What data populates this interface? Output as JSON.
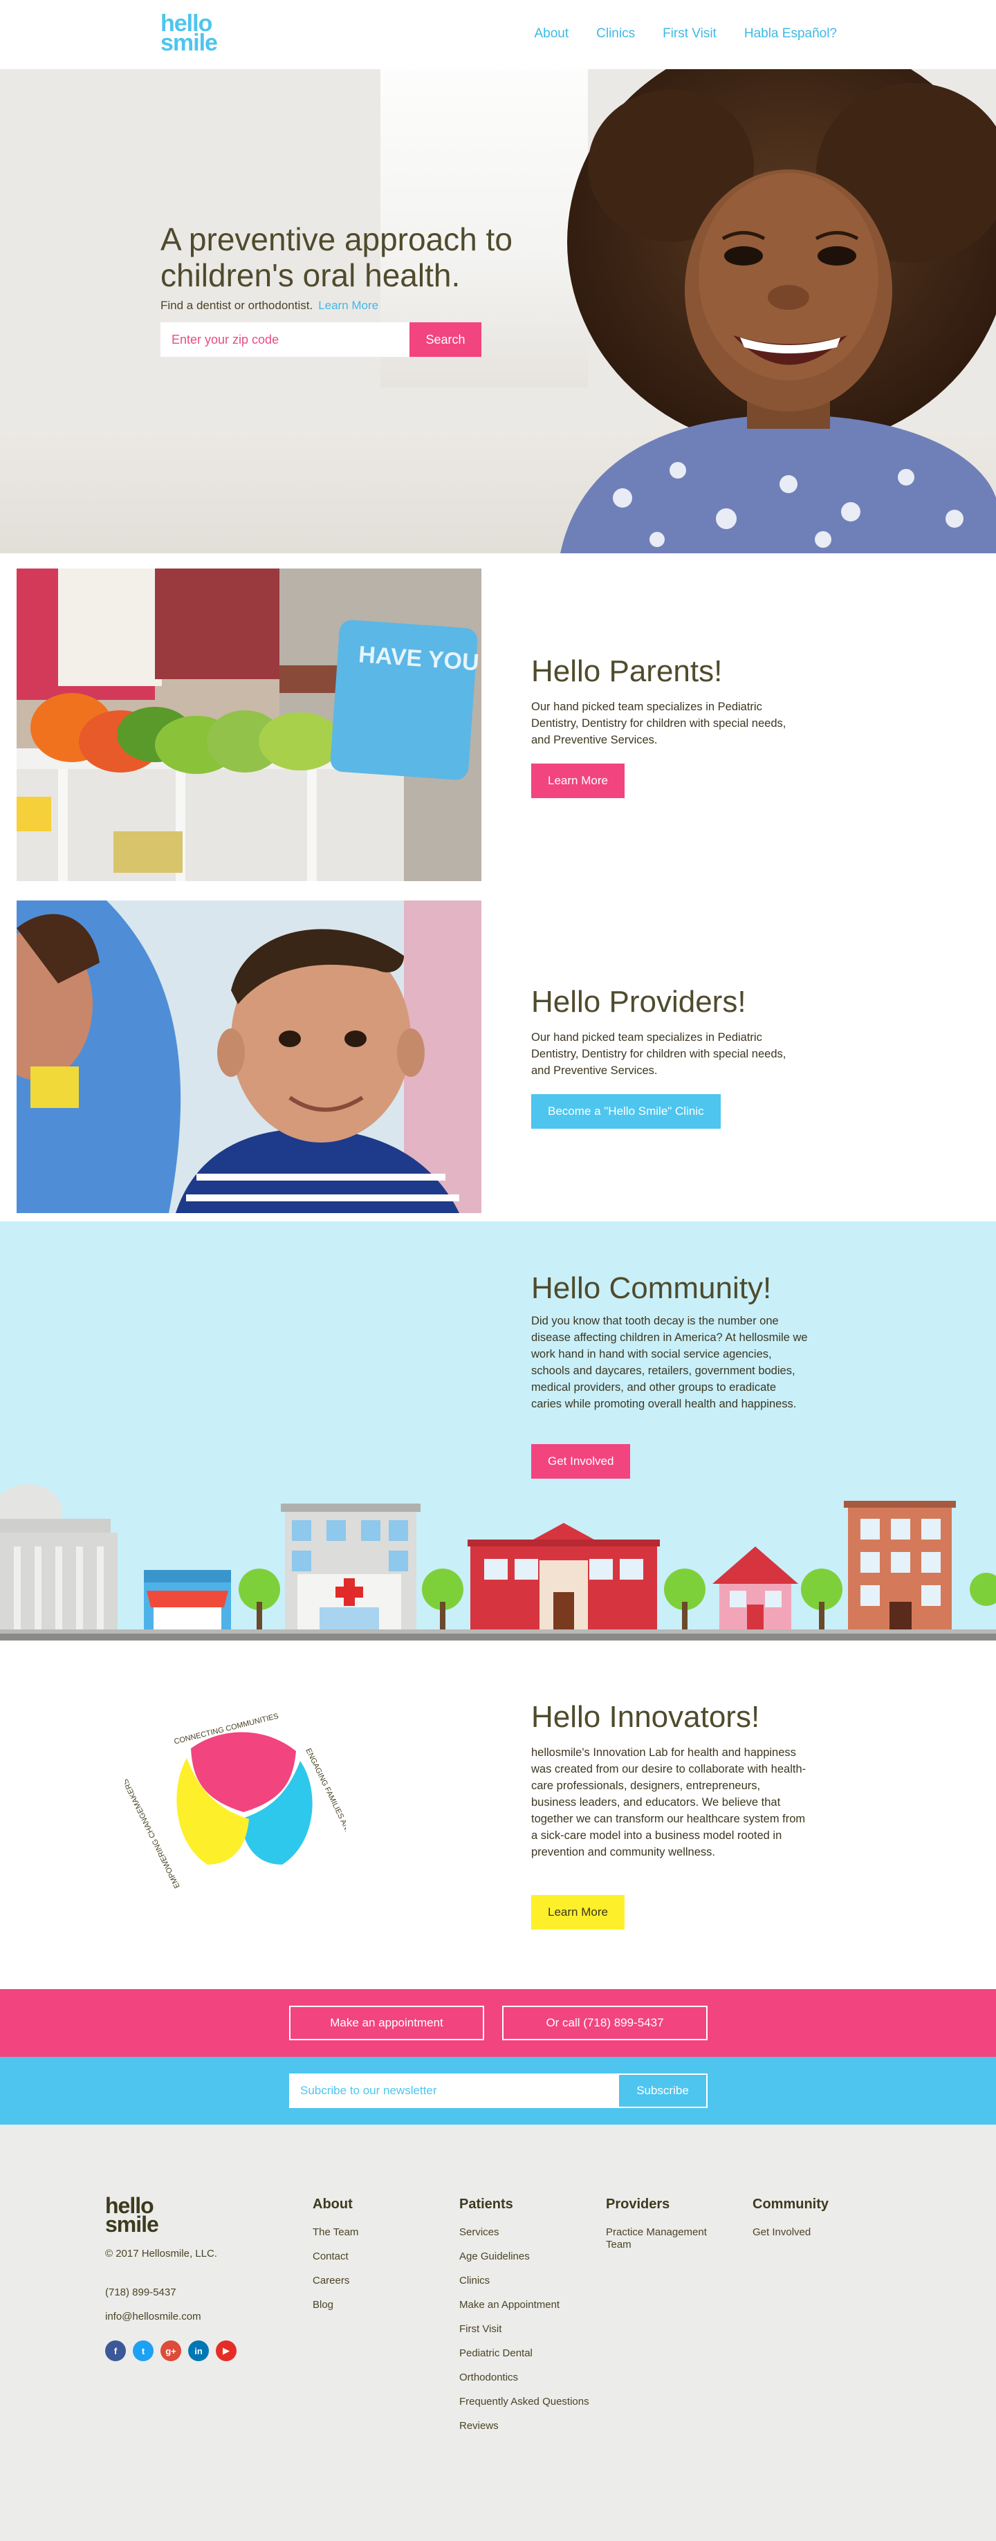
{
  "header": {
    "logo_line1": "hello",
    "logo_line2": "smile",
    "nav": [
      "About",
      "Clinics",
      "First Visit",
      "Habla Español?"
    ]
  },
  "hero": {
    "title": "A preventive approach to children's oral health.",
    "subtitle": "Find a dentist or orthodontist.",
    "learn_more": "Learn More",
    "zip_placeholder": "Enter your zip code",
    "search_label": "Search"
  },
  "parents": {
    "title": "Hello Parents!",
    "text": "Our hand picked team specializes in Pediatric Dentistry, Dentistry for children with special needs, and Preventive Services.",
    "button": "Learn More",
    "pillow_text": "HAVE YOU BRUSHED YOUR TEETH"
  },
  "providers": {
    "title": "Hello Providers!",
    "text": "Our hand picked team specializes in Pediatric Dentistry, Dentistry for children with special needs, and Preventive Services.",
    "button": "Become a \"Hello Smile\" Clinic"
  },
  "community": {
    "title": "Hello Community!",
    "text": "Did you know that tooth decay is the number one disease affecting children in America? At hellosmile we work hand in hand with social service agencies, schools and daycares, retailers, government bodies, medical providers, and other groups to eradicate caries while promoting overall health and happiness.",
    "button": "Get Involved"
  },
  "innovators": {
    "title": "Hello Innovators!",
    "text": "hellosmile's Innovation Lab for health and happiness was created from our desire to collaborate with health-care professionals, designers, entrepreneurs, business leaders, and educators. We believe that together we can transform our healthcare system from a sick-care model into a business model rooted in prevention and community wellness.",
    "button": "Learn More",
    "ring_labels": [
      "CONNECTING COMMUNITIES",
      "ENGAGING FAMILIES AND CHILDREN",
      "EMPOWERING CHANGEMAKERS"
    ]
  },
  "cta": {
    "appointment": "Make an appointment",
    "call": "Or call (718) 899-5437",
    "newsletter_placeholder": "Subcribe to our newsletter",
    "subscribe": "Subscribe"
  },
  "footer": {
    "logo_line1": "hello",
    "logo_line2": "smile",
    "copyright": "© 2017 Hellosmile, LLC.",
    "phone": "(718) 899-5437",
    "email": "info@hellosmile.com",
    "social_icons": [
      "facebook-icon",
      "twitter-icon",
      "google-plus-icon",
      "linkedin-icon",
      "youtube-icon"
    ],
    "columns": [
      {
        "title": "About",
        "links": [
          "The Team",
          "Contact",
          "Careers",
          "Blog"
        ]
      },
      {
        "title": "Patients",
        "links": [
          "Services",
          "Age Guidelines",
          "Clinics",
          "Make an Appointment",
          "First Visit",
          "Pediatric Dental",
          "Orthodontics",
          "Frequently Asked Questions",
          "Reviews"
        ]
      },
      {
        "title": "Providers",
        "links": [
          "Practice Management Team"
        ]
      },
      {
        "title": "Community",
        "links": [
          "Get Involved"
        ]
      }
    ]
  },
  "colors": {
    "pink": "#f2447f",
    "blue": "#4ec5ee",
    "yellow": "#fdf02b",
    "olive_text": "#4f4b2c",
    "community_bg": "#c9eff9",
    "footer_bg": "#ececea"
  }
}
